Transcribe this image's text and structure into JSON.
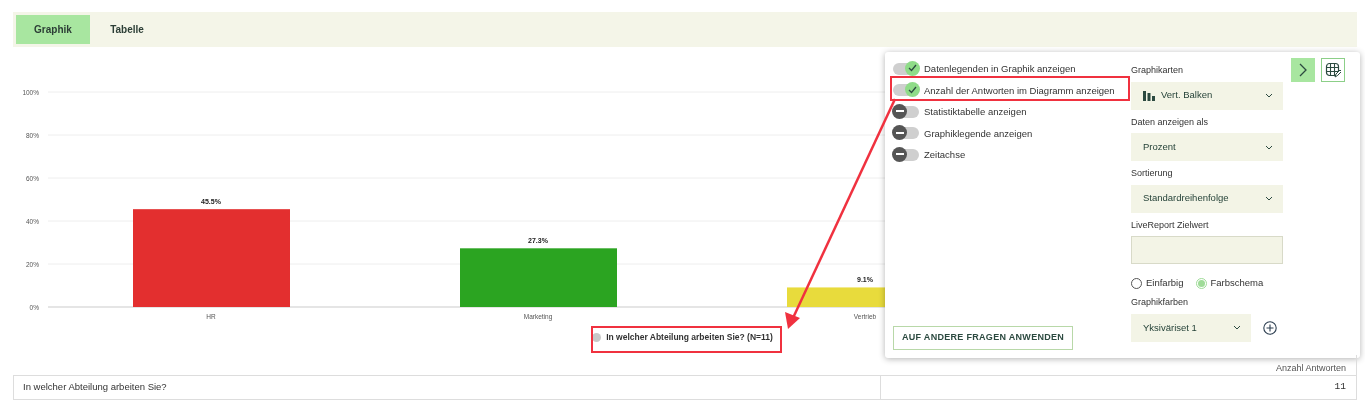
{
  "tabs": [
    {
      "label": "Graphik",
      "selected": true
    },
    {
      "label": "Tabelle",
      "selected": false
    }
  ],
  "chart": {
    "legend": {
      "color": "#c8c8c8"
    },
    "chart_data": {
      "type": "bar",
      "categories": [
        "HR",
        "Marketing",
        "Vertrieb"
      ],
      "grid": true,
      "series": [
        {
          "name": "In welcher Abteilung arbeiten Sie? (N=11)",
          "color": "#e32f2f",
          "values": [
            45.5,
            null,
            null
          ]
        },
        {
          "color": "#2ba421",
          "values": [
            null,
            27.3,
            null
          ]
        },
        {
          "color": "#e8db3c",
          "values": [
            null,
            null,
            9.1
          ]
        }
      ],
      "ylim": [
        0,
        100
      ],
      "yticks": [
        {
          "value": 0,
          "label": "0%"
        },
        {
          "value": 20,
          "label": "20%"
        },
        {
          "value": 40,
          "label": "40%"
        },
        {
          "value": 60,
          "label": "60%"
        },
        {
          "value": 80,
          "label": "80%"
        },
        {
          "value": 100,
          "label": "100%"
        }
      ],
      "value_labels": [
        "45.5%",
        "27.3%",
        "9.1%"
      ]
    }
  },
  "table": {
    "header": "Anzahl Antworten",
    "rows": [
      {
        "question": "In welcher Abteilung arbeiten Sie?",
        "count": "11"
      }
    ]
  },
  "settings_panel": {
    "toggles": [
      {
        "label": "Datenlegenden in Graphik anzeigen",
        "checked": true
      },
      {
        "label": "Anzahl der Antworten im Diagramm anzeigen",
        "checked": true
      },
      {
        "label": "Statistiktabelle anzeigen",
        "checked": false
      },
      {
        "label": "Graphiklegende anzeigen",
        "checked": false
      },
      {
        "label": "Zeitachse",
        "checked": false
      }
    ],
    "chart_type": {
      "label": "Graphikarten",
      "value": "Vert. Balken"
    },
    "display_as": {
      "label": "Daten anzeigen als",
      "value": "Prozent"
    },
    "sorting": {
      "label": "Sortierung",
      "value": "Standardreihenfolge"
    },
    "target": {
      "label": "LiveReport Zielwert"
    },
    "color_mode": [
      {
        "label": "Einfarbig",
        "selected": false
      },
      {
        "label": "Farbschema",
        "selected": true
      }
    ],
    "chart_colors": {
      "label": "Graphikfarben",
      "value": "Yksiväriset 1"
    },
    "apply_button": "AUF ANDERE FRAGEN ANWENDEN"
  }
}
